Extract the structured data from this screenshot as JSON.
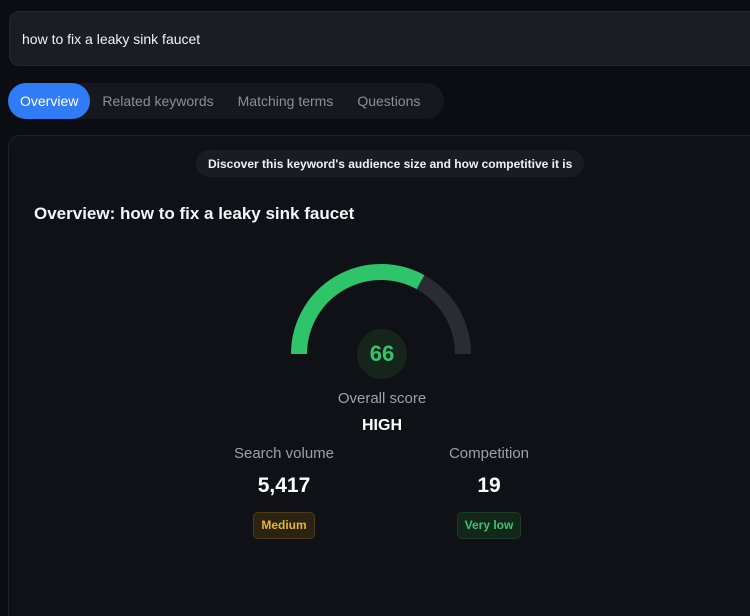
{
  "search": {
    "value": "how to fix a leaky sink faucet"
  },
  "tabs": [
    {
      "label": "Overview",
      "active": true
    },
    {
      "label": "Related keywords",
      "active": false
    },
    {
      "label": "Matching terms",
      "active": false
    },
    {
      "label": "Questions",
      "active": false
    }
  ],
  "panel": {
    "hint": "Discover this keyword's audience size and how competitive it is",
    "title": "Overview: how to fix a leaky sink faucet"
  },
  "score": {
    "value": "66",
    "fraction": 0.66,
    "label": "Overall score",
    "level": "HIGH"
  },
  "metrics": {
    "search_volume": {
      "label": "Search volume",
      "value": "5,417",
      "badge": "Medium"
    },
    "competition": {
      "label": "Competition",
      "value": "19",
      "badge": "Very low"
    }
  },
  "colors": {
    "accent": "#2f7cf6",
    "gauge_fill": "#2ec46a",
    "gauge_track": "#2a2c34",
    "badge_medium": "#e5b334",
    "badge_low": "#3cc46f"
  }
}
